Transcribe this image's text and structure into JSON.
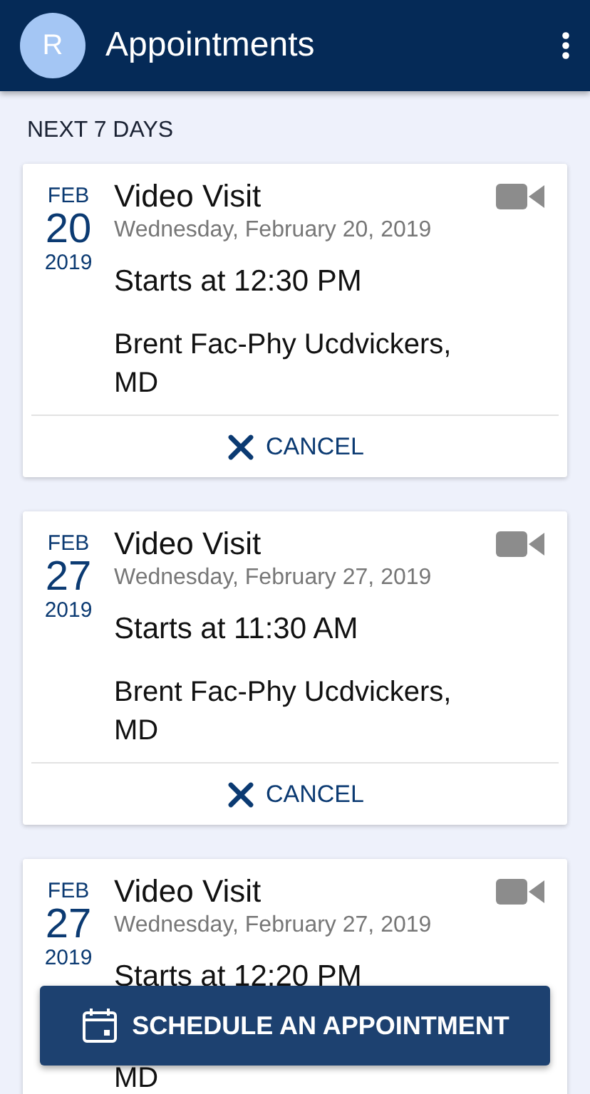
{
  "header": {
    "avatar_initial": "R",
    "title": "Appointments"
  },
  "section_title": "NEXT 7 DAYS",
  "appointments": [
    {
      "month": "FEB",
      "day": "20",
      "year": "2019",
      "type": "Video Visit",
      "date": "Wednesday, February 20, 2019",
      "starts": "Starts at 12:30 PM",
      "provider_lines": [
        "Brent Fac-Phy Ucdvickers,",
        "MD"
      ],
      "cancel_label": "CANCEL"
    },
    {
      "month": "FEB",
      "day": "27",
      "year": "2019",
      "type": "Video Visit",
      "date": "Wednesday, February 27, 2019",
      "starts": "Starts at 11:30 AM",
      "provider_lines": [
        "Brent Fac-Phy Ucdvickers,",
        "MD"
      ],
      "cancel_label": "CANCEL"
    },
    {
      "month": "FEB",
      "day": "27",
      "year": "2019",
      "type": "Video Visit",
      "date": "Wednesday, February 27, 2019",
      "starts": "Starts at 12:20 PM",
      "provider_lines": [
        "MD"
      ]
    }
  ],
  "schedule_button": "SCHEDULE AN APPOINTMENT"
}
